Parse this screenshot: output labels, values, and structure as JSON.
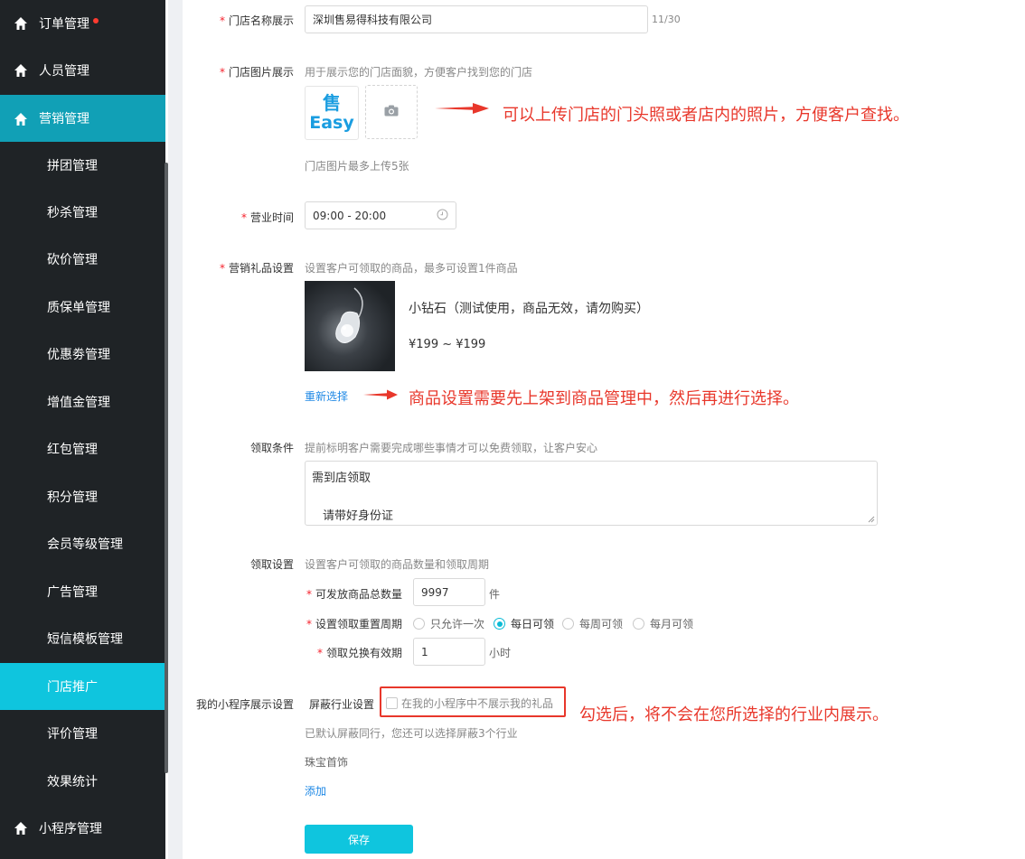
{
  "sidebar": {
    "top_items": [
      {
        "label": "订单管理",
        "icon": "home-icon",
        "badge": true
      },
      {
        "label": "人员管理",
        "icon": "home-icon"
      },
      {
        "label": "营销管理",
        "icon": "home-icon",
        "active": true
      }
    ],
    "sub_items": [
      "拼团管理",
      "秒杀管理",
      "砍价管理",
      "质保单管理",
      "优惠劵管理",
      "增值金管理",
      "红包管理",
      "积分管理",
      "会员等级管理",
      "广告管理",
      "短信模板管理",
      "门店推广",
      "评价管理",
      "效果统计"
    ],
    "active_sub": "门店推广",
    "bottom_item": {
      "label": "小程序管理",
      "icon": "home-icon"
    }
  },
  "form": {
    "store_name": {
      "label": "门店名称展示",
      "value": "深圳售易得科技有限公司",
      "counter": "11/30"
    },
    "store_image": {
      "label": "门店图片展示",
      "hint": "用于展示您的门店面貌，方便客户找到您的门店",
      "logo_text_top": "售",
      "logo_text_bottom": "Easy",
      "limit_hint": "门店图片最多上传5张",
      "annotation": "可以上传门店的门头照或者店内的照片，方便客户查找。"
    },
    "business_hours": {
      "label": "营业时间",
      "value": "09:00 - 20:00"
    },
    "gift": {
      "label": "营销礼品设置",
      "hint": "设置客户可领取的商品，最多可设置1件商品",
      "product_name": "小钻石（测试使用，商品无效，请勿购买）",
      "product_price": "¥199 ~ ¥199",
      "reselect": "重新选择",
      "annotation": "商品设置需要先上架到商品管理中，然后再进行选择。"
    },
    "conditions": {
      "label": "领取条件",
      "hint": "提前标明客户需要完成哪些事情才可以免费领取，让客户安心",
      "line1": "需到店领取",
      "line2": "请带好身份证"
    },
    "claim": {
      "label": "领取设置",
      "hint": "设置客户可领取的商品数量和领取周期",
      "total_label": "可发放商品总数量",
      "total_value": "9997",
      "total_unit": "件",
      "period_label": "设置领取重置周期",
      "period_options": [
        "只允许一次",
        "每日可领",
        "每周可领",
        "每月可领"
      ],
      "period_selected": "每日可领",
      "validity_label": "领取兑换有效期",
      "validity_value": "1",
      "validity_unit": "小时"
    },
    "miniapp": {
      "label": "我的小程序展示设置",
      "block_label": "屏蔽行业设置",
      "checkbox_label": "在我的小程序中不展示我的礼品",
      "annotation": "勾选后，将不会在您所选择的行业内展示。",
      "hint": "已默认屏蔽同行，您还可以选择屏蔽3个行业",
      "industry": "珠宝首饰",
      "add": "添加"
    },
    "save": "保存"
  },
  "colors": {
    "sidebar_bg": "#1f2326",
    "active_top": "#11a0b6",
    "active_sub": "#0fc5de",
    "annotation": "#e8372b",
    "button": "#0fc5de",
    "link": "#1e88e5"
  }
}
